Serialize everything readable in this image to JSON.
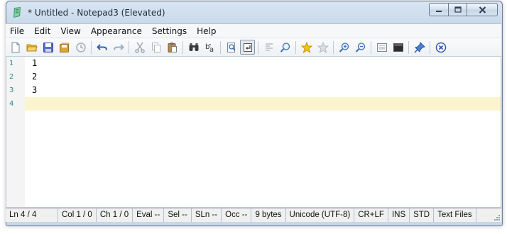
{
  "window": {
    "title": "* Untitled - Notepad3 (Elevated)",
    "app_icon": "notepad3-icon",
    "caption_buttons": [
      "minimize-icon",
      "maximize-icon",
      "close-icon"
    ]
  },
  "menu": {
    "items": [
      "File",
      "Edit",
      "View",
      "Appearance",
      "Settings",
      "Help"
    ]
  },
  "toolbar": {
    "buttons": [
      "new-file-icon",
      "open-folder-icon",
      "save-icon",
      "save-as-icon",
      "browse-icon",
      "undo-icon",
      "redo-icon",
      "cut-icon",
      "copy-icon",
      "paste-icon",
      "find-icon",
      "replace-icon",
      "goto-icon",
      "word-wrap-icon",
      "wrap-indent-icon",
      "zoom-find-icon",
      "favorite-icon",
      "add-favorite-icon",
      "zoom-in-icon",
      "zoom-out-icon",
      "scheme-icon",
      "customize-icon",
      "pin-icon",
      "exit-icon"
    ],
    "pressed": "word-wrap-icon"
  },
  "editor": {
    "lines": [
      {
        "number": "1",
        "text": "1"
      },
      {
        "number": "2",
        "text": "2"
      },
      {
        "number": "3",
        "text": "3"
      },
      {
        "number": "4",
        "text": ""
      }
    ],
    "current_line": 4
  },
  "status": {
    "ln": "Ln  4 / 4",
    "col": "Col  1 / 0",
    "ch": "Ch  1 / 0",
    "eval": "Eval  --",
    "sel": "Sel  --",
    "sln": "SLn  --",
    "occ": "Occ  --",
    "size": "9 bytes",
    "encoding": "Unicode (UTF-8)",
    "eol": "CR+LF",
    "ovr": "INS",
    "mode": "STD",
    "lexer": "Text Files"
  },
  "colors": {
    "current_line": "#fbf5cf",
    "line_number": "#2b8a8a",
    "title_bar": "#c8d8ea"
  }
}
